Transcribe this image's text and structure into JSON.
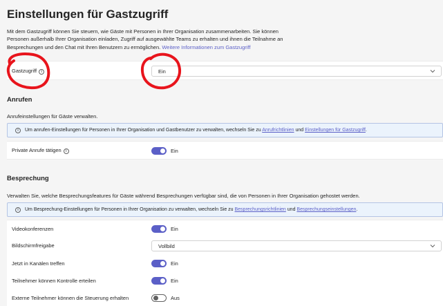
{
  "page": {
    "title": "Einstellungen für Gastzugriff",
    "intro_line1": "Mit dem Gastzugriff können Sie steuern, wie Gäste mit Personen in Ihrer Organisation zusammenarbeiten. Sie können",
    "intro_line2": "Personen außerhalb Ihrer Organisation einladen, Zugriff auf ausgewählte Teams zu erhalten und ihnen die Teilnahme an",
    "intro_line3": "Besprechungen und den Chat mit Ihren Benutzern zu ermöglichen.",
    "intro_link": "Weitere Informationen zum Gastzugriff"
  },
  "guest_access": {
    "label": "Gastzugriff",
    "value": "Ein"
  },
  "calling": {
    "heading": "Anrufen",
    "description": "Anrufeinstellungen für Gäste verwalten.",
    "banner_text": "Um anrufen-Einstellungen für Personen in Ihrer Organisation und Gastbenutzer zu verwalten, wechseln Sie zu",
    "banner_link1": "Anrufrichtlinien",
    "banner_and": "und",
    "banner_link2": "Einstellungen für Gastzugriff",
    "banner_end": ".",
    "private_calls_label": "Private Anrufe tätigen",
    "private_calls_value": "Ein",
    "private_calls_on": true
  },
  "meeting": {
    "heading": "Besprechung",
    "description": "Verwalten Sie, welche Besprechungsfeatures für Gäste während Besprechungen verfügbar sind, die von Personen in Ihrer Organisation gehostet werden.",
    "banner_text": "Um Besprechung-Einstellungen für Personen in Ihrer Organisation zu verwalten, wechseln Sie zu",
    "banner_link1": "Besprechungsrichtlinien",
    "banner_and": "und",
    "banner_link2": "Besprechungseinstellungen",
    "banner_end": ".",
    "video_label": "Videokonferenzen",
    "video_value": "Ein",
    "screenshare_label": "Bildschirmfreigabe",
    "screenshare_value": "Vollbild",
    "meetnow_label": "Jetzt in Kanälen treffen",
    "meetnow_value": "Ein",
    "give_control_label": "Teilnehmer können Kontrolle erteilen",
    "give_control_value": "Ein",
    "external_control_label": "Externe Teilnehmer können die Steuerung erhalten",
    "external_control_value": "Aus"
  },
  "annotations": {
    "color": "#e8141c"
  },
  "colors": {
    "accent": "#5b5fc7",
    "banner_bg": "#ebf3fc"
  }
}
